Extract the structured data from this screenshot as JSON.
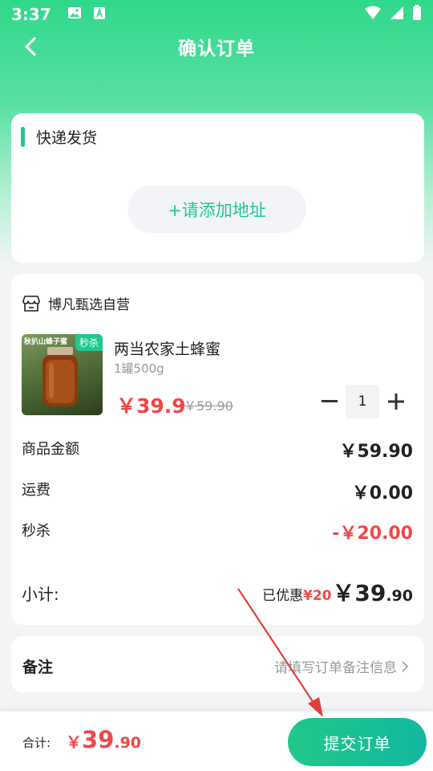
{
  "status_bar": {
    "time": "3:37"
  },
  "header": {
    "title": "确认订单"
  },
  "shipping": {
    "title": "快递发货",
    "add_address_label": "+请添加地址"
  },
  "order": {
    "store_name": "博凡甄选自营",
    "product": {
      "name": "两当农家土蜂蜜",
      "spec": "1罐500g",
      "tag": "秒杀",
      "image_caption": "秋扒山蜂子蜜",
      "price": "￥39.9",
      "original_price": "￥59.90",
      "quantity": "1"
    },
    "rows": [
      {
        "label": "商品金额",
        "value": "￥59.90"
      },
      {
        "label": "运费",
        "value": "￥0.00"
      },
      {
        "label": "秒杀",
        "value": "-￥20.00"
      }
    ],
    "subtotal": {
      "label": "小计:",
      "saved_prefix": "已优惠",
      "saved_amount": "¥20",
      "value_main": "￥39",
      "value_decimal": ".90"
    }
  },
  "note": {
    "label": "备注",
    "placeholder": "请填写订单备注信息"
  },
  "footer": {
    "total_label": "合计:",
    "total_currency": "￥",
    "total_main": "39",
    "total_decimal": ".90",
    "submit_label": "提交订单"
  },
  "colors": {
    "brand_green": "#20c78a",
    "price_red": "#f04848",
    "annotation_arrow": "#e0403a"
  }
}
